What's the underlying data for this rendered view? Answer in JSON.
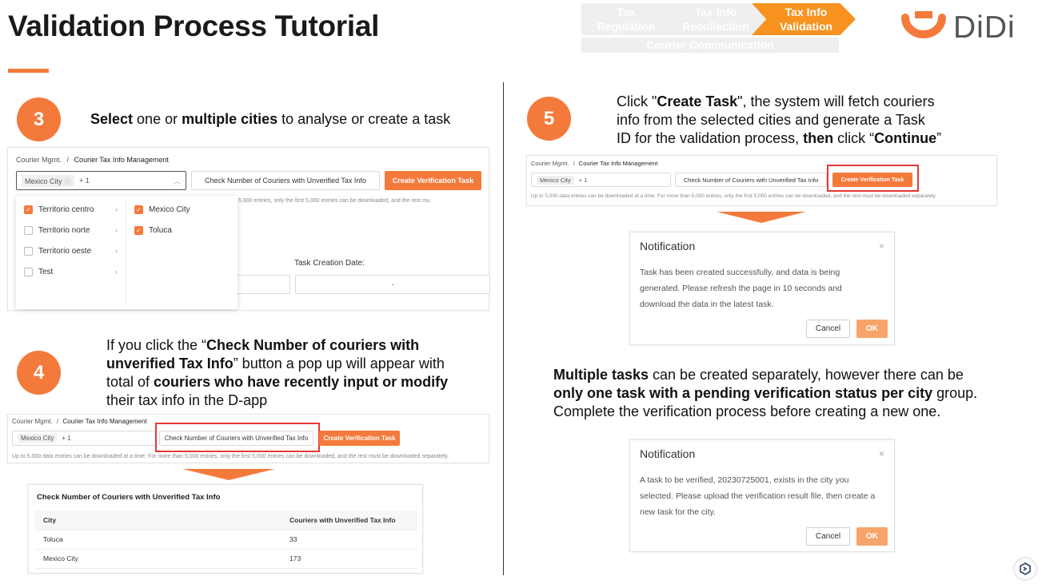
{
  "header": {
    "title": "Validation Process Tutorial",
    "steps": [
      "Tax\nRegulation",
      "Tax Info\nRecollection",
      "Tax Info\nValidation"
    ],
    "step_lines": [
      [
        "Tax",
        "Regulation"
      ],
      [
        "Tax Info",
        "Recollection"
      ],
      [
        "Tax Info",
        "Validation"
      ]
    ],
    "courier_communication": "Courier Communication",
    "logo_text": "DiDi",
    "accent_color": "#f47a3c",
    "active_step_color": "#f7931e"
  },
  "step3": {
    "number": "3",
    "text_parts": [
      {
        "t": "Select",
        "b": true
      },
      {
        "t": " one or ",
        "b": false
      },
      {
        "t": "multiple cities",
        "b": true
      },
      {
        "t": " to analyse or create a task",
        "b": false
      }
    ],
    "panel": {
      "breadcrumb_root": "Courier Mgmt.",
      "breadcrumb_sep": "/",
      "breadcrumb_page": "Courier Tax Info Management",
      "city_tag": "Mexico City",
      "tag_more": "+ 1",
      "check_button": "Check Number of Couriers with Unverified Tax Info",
      "create_button": "Create Verification Task",
      "hint_partial": "5,000 entries, only the first 5,000 entries can be downloaded, and the rest mu",
      "task_creation_date_label": "Task Creation Date:",
      "date_placeholder": "-",
      "regions": [
        {
          "label": "Territorio centro",
          "checked": true
        },
        {
          "label": "Territorio norte",
          "checked": false
        },
        {
          "label": "Territorio oeste",
          "checked": false
        },
        {
          "label": "Test",
          "checked": false
        }
      ],
      "cities": [
        {
          "label": "Mexico City",
          "checked": true
        },
        {
          "label": "Toluca",
          "checked": true
        }
      ]
    }
  },
  "step4": {
    "number": "4",
    "lines": [
      [
        {
          "t": "If you click the “",
          "b": false
        },
        {
          "t": "Check Number of couriers with",
          "b": true
        }
      ],
      [
        {
          "t": "unverified Tax Info",
          "b": true
        },
        {
          "t": "” button a pop up will appear with",
          "b": false
        }
      ],
      [
        {
          "t": "total of ",
          "b": false
        },
        {
          "t": "couriers who have recently input or modify",
          "b": true
        }
      ],
      [
        {
          "t": "their tax info in the D-app",
          "b": false
        }
      ]
    ],
    "panel": {
      "breadcrumb_root": "Courier Mgmt.",
      "breadcrumb_sep": "/",
      "breadcrumb_page": "Courier Tax Info Management",
      "city_tag": "Mexico City",
      "tag_more": "+ 1",
      "check_button": "Check Number of Couriers with Unverified Tax Info",
      "create_button": "Create Verification Task",
      "hint": "Up to 5,000 data entries can be downloaded at a time. For more than 5,000 entries, only the first 5,000 entries can be downloaded, and the rest must be downloaded separately."
    },
    "popup": {
      "title": "Check Number of Couriers with Unverified Tax Info",
      "col_city": "City",
      "col_count": "Couriers with Unverified Tax Info",
      "rows": [
        {
          "city": "Toluca",
          "count": "33"
        },
        {
          "city": "Mexico City",
          "count": "173"
        }
      ]
    }
  },
  "step5": {
    "number": "5",
    "lines": [
      [
        {
          "t": "Click \"",
          "b": false
        },
        {
          "t": "Create Task",
          "b": true
        },
        {
          "t": "\", the system will fetch couriers",
          "b": false
        }
      ],
      [
        {
          "t": "info from the selected cities and generate a Task",
          "b": false
        }
      ],
      [
        {
          "t": "ID for the validation process, ",
          "b": false
        },
        {
          "t": "then",
          "b": true
        },
        {
          "t": " click “",
          "b": false
        },
        {
          "t": "Continue",
          "b": true
        },
        {
          "t": "”",
          "b": false
        }
      ]
    ],
    "panel": {
      "breadcrumb_root": "Courier Mgmt.",
      "breadcrumb_sep": "/",
      "breadcrumb_page": "Courier Tax Info Management",
      "city_tag": "Mexico City",
      "tag_more": "+ 1",
      "check_button": "Check Number of Couriers with Unverified Tax Info",
      "create_button": "Create Verification Task",
      "hint": "Up to 5,000 data entries can be downloaded at a time. For more than 5,000 entries, only the first 5,000 entries can be downloaded, and the rest must be downloaded separately."
    },
    "notification1": {
      "title": "Notification",
      "close": "×",
      "body_lines": [
        "Task has been created successfully, and data is being",
        "generated. Please refresh the page in 10 seconds and",
        "download the data in the latest task."
      ],
      "cancel": "Cancel",
      "ok": "OK"
    }
  },
  "multi": {
    "lines": [
      [
        {
          "t": "Multiple tasks",
          "b": true
        },
        {
          "t": " can be created separately, however there can be",
          "b": false
        }
      ],
      [
        {
          "t": "only one task with a pending verification status per city",
          "b": true
        },
        {
          "t": " group.",
          "b": false
        }
      ],
      [
        {
          "t": "Complete the verification process before creating a new one.",
          "b": false
        }
      ]
    ],
    "notification2": {
      "title": "Notification",
      "close": "×",
      "body_lines": [
        "A task to be verified, 20230725001, exists in the city you",
        "selected. Please upload the verification result file, then create a",
        "new task for the city."
      ],
      "cancel": "Cancel",
      "ok": "OK"
    }
  },
  "help_icon": "support-icon"
}
